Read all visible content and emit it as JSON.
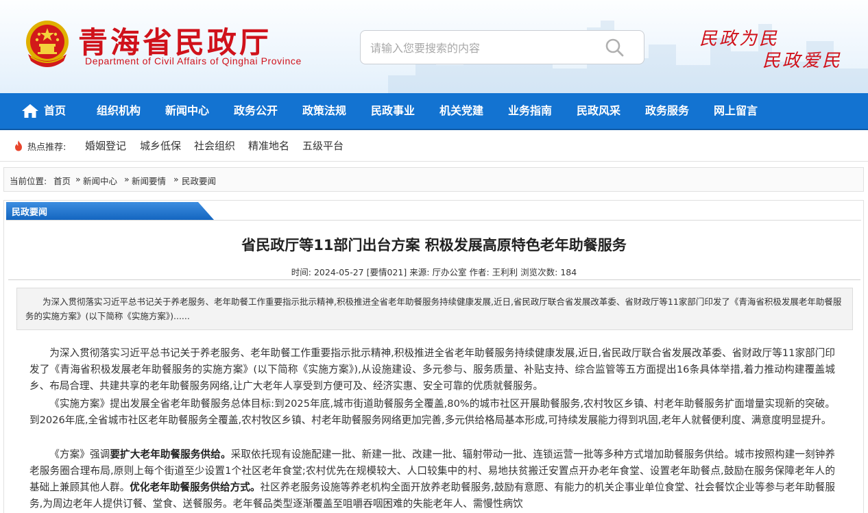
{
  "header": {
    "site_title_cn": "青海省民政厅",
    "site_title_en": "Department of Civil Affairs of Qinghai Province",
    "slogan_line1": "民政为民",
    "slogan_line2": "民政爱民",
    "brand_color": "#d0121b"
  },
  "search": {
    "placeholder": "请输入您要搜索的内容",
    "value": ""
  },
  "nav": {
    "background": "#1373d1",
    "items": [
      "首页",
      "组织机构",
      "新闻中心",
      "政务公开",
      "政策法规",
      "民政事业",
      "机关党建",
      "业务指南",
      "民政风采",
      "政务服务",
      "网上留言"
    ]
  },
  "hot": {
    "label": "热点推荐:",
    "links": [
      "婚姻登记",
      "城乡低保",
      "社会组织",
      "精准地名",
      "五级平台"
    ]
  },
  "breadcrumb": {
    "prefix": "当前位置:",
    "items": [
      "首页",
      "新闻中心",
      "新闻要情",
      "民政要闻"
    ],
    "separator": "»"
  },
  "section": {
    "tab_label": "民政要闻"
  },
  "article": {
    "title": "省民政厅等11部门出台方案 积极发展高原特色老年助餐服务",
    "meta": {
      "time_label": "时间:",
      "time": "2024-05-27",
      "doc_no": "[要情021]",
      "source_label": "来源:",
      "source": "厅办公室",
      "author_label": "作者:",
      "author": "王利利",
      "views_label": "浏览次数:",
      "views": "184"
    },
    "summary": "为深入贯彻落实习近平总书记关于养老服务、老年助餐工作重要指示批示精神,积极推进全省老年助餐服务持续健康发展,近日,省民政厅联合省发展改革委、省财政厅等11家部门印发了《青海省积极发展老年助餐服务的实施方案》(以下简称《实施方案》)......",
    "p1": "为深入贯彻落实习近平总书记关于养老服务、老年助餐工作重要指示批示精神,积极推进全省老年助餐服务持续健康发展,近日,省民政厅联合省发展改革委、省财政厅等11家部门印发了《青海省积极发展老年助餐服务的实施方案》(以下简称《实施方案》),从设施建设、多元参与、服务质量、补贴支持、综合监管等五方面提出16条具体举措,着力推动构建覆盖城乡、布局合理、共建共享的老年助餐服务网络,让广大老年人享受到方便可及、经济实惠、安全可靠的优质就餐服务。",
    "p2": "《实施方案》提出发展全省老年助餐服务总体目标:到2025年底,城市街道助餐服务全覆盖,80%的城市社区开展助餐服务,农村牧区乡镇、村老年助餐服务扩面增量实现新的突破。到2026年底,全省城市社区老年助餐服务全覆盖,农村牧区乡镇、村老年助餐服务网络更加完善,多元供给格局基本形成,可持续发展能力得到巩固,老年人就餐便利度、满意度明显提升。",
    "p3_a": "《方案》强调",
    "p3_b": "要扩大老年助餐服务供给。",
    "p3_c": "采取依托现有设施配建一批、新建一批、改建一批、辐射带动一批、连锁运营一批等多种方式增加助餐服务供给。城市按照构建一刻钟养老服务圈合理布局,原则上每个街道至少设置1个社区老年食堂;农村优先在规模较大、人口较集中的村、易地扶贫搬迁安置点开办老年食堂、设置老年助餐点,鼓励在服务保障老年人的基础上兼顾其他人群。",
    "p3_d": "优化老年助餐服务供给方式。",
    "p3_e": "社区养老服务设施等养老机构全面开放养老助餐服务,鼓励有意愿、有能力的机关企事业单位食堂、社会餐饮企业等参与老年助餐服务,为周边老年人提供订餐、堂食、送餐服务。老年餐品类型逐渐覆盖至咀嚼吞咽困难的失能老年人、需慢性病饮"
  }
}
